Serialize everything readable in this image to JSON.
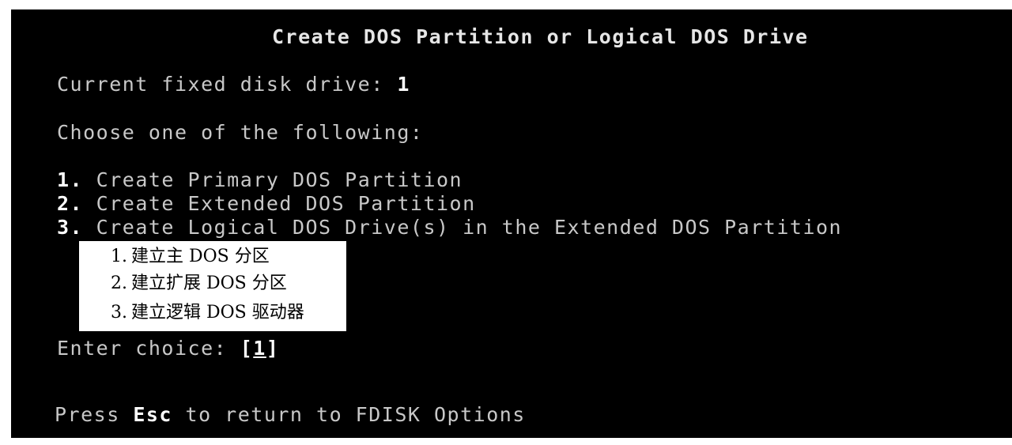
{
  "screen": {
    "title": "Create DOS Partition or Logical DOS Drive",
    "current_drive_label": "Current fixed disk drive: ",
    "current_drive_value": "1",
    "choose_prompt": "Choose one of the following:",
    "options": [
      {
        "number": "1.",
        "label": "Create Primary DOS Partition"
      },
      {
        "number": "2.",
        "label": "Create Extended DOS Partition"
      },
      {
        "number": "3.",
        "label": "Create Logical DOS Drive(s) in the Extended DOS Partition"
      }
    ],
    "enter_choice_label": "Enter choice: ",
    "enter_choice_open": "[",
    "enter_choice_value": "1",
    "enter_choice_close": "]",
    "footer_prefix": "Press ",
    "footer_key": "Esc",
    "footer_suffix": " to return to FDISK Options"
  },
  "translation_overlay": {
    "items": [
      {
        "number": "1.",
        "label": "建立主 DOS 分区"
      },
      {
        "number": "2.",
        "label": "建立扩展 DOS 分区"
      },
      {
        "number": "3.",
        "label": "建立逻辑 DOS 驱动器"
      }
    ]
  },
  "colors": {
    "background": "#000000",
    "text": "#c8c8c8",
    "bright_text": "#ffffff",
    "overlay_background": "#ffffff",
    "overlay_text": "#000000"
  }
}
